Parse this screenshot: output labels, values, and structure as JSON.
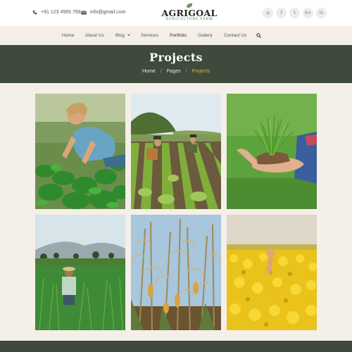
{
  "topbar": {
    "phone": "+91 123 4565 789",
    "email": "info@gmail.com",
    "phone_icon": "phone-icon",
    "email_icon": "envelope-icon"
  },
  "logo": {
    "name": "AGRIGOAL",
    "tagline": "AGRICULTURE FARM"
  },
  "socials": [
    {
      "icon": "rss-icon",
      "glyph": "◎"
    },
    {
      "icon": "facebook-icon",
      "glyph": "f"
    },
    {
      "icon": "twitter-icon",
      "glyph": "t"
    },
    {
      "icon": "google-plus-icon",
      "glyph": "G+"
    },
    {
      "icon": "linkedin-icon",
      "glyph": "in"
    }
  ],
  "nav": {
    "home": "Home",
    "about": "About Us",
    "blog": "Blog",
    "services": "Services",
    "portfolio": "Portfolio",
    "gallery": "Gallery",
    "contact": "Contact Us",
    "active": "Portfolio"
  },
  "banner": {
    "title": "Projects",
    "breadcrumb": [
      "Home",
      "Pages",
      "Projects"
    ],
    "separator": "/"
  },
  "gallery": [
    {
      "icon": "photo-woman-planting-greens"
    },
    {
      "icon": "photo-farmers-in-rows"
    },
    {
      "icon": "photo-hand-holding-seedling"
    },
    {
      "icon": "photo-farmer-in-field"
    },
    {
      "icon": "photo-corn-stalks"
    },
    {
      "icon": "photo-hand-in-yellow-flowers"
    }
  ],
  "colors": {
    "brand_dark": "#3e4a3c",
    "accent_gold": "#d9b14a",
    "nav_text": "#4c5e40",
    "page_bg": "#f4efe9"
  }
}
